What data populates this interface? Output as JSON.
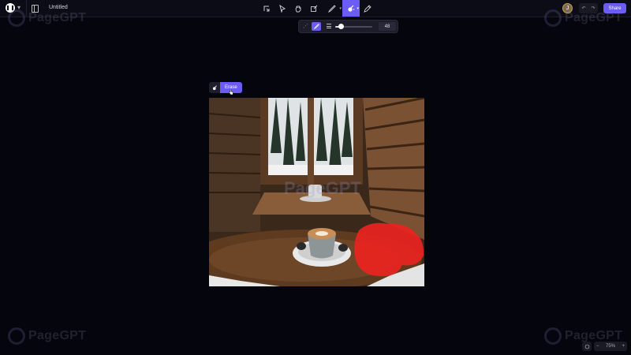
{
  "header": {
    "title": "Untitled",
    "avatar_initial": "J",
    "share_label": "Share"
  },
  "toolbar": {
    "tools": [
      {
        "name": "frame",
        "icon": "frame-icon"
      },
      {
        "name": "select",
        "icon": "cursor-icon"
      },
      {
        "name": "hand",
        "icon": "hand-icon"
      },
      {
        "name": "edit",
        "icon": "edit-icon"
      },
      {
        "name": "draw",
        "icon": "pen-icon"
      },
      {
        "name": "magic",
        "icon": "magic-brush-icon",
        "active": true
      },
      {
        "name": "dropper",
        "icon": "eyedropper-icon"
      }
    ]
  },
  "brush": {
    "size_value": "48",
    "size_fraction": 0.15
  },
  "context": {
    "erase_label": "Erase"
  },
  "watermark": "PageGPT",
  "zoom": {
    "minus": "−",
    "level": "75%",
    "plus": "+"
  },
  "accent": "#6a5cf5"
}
